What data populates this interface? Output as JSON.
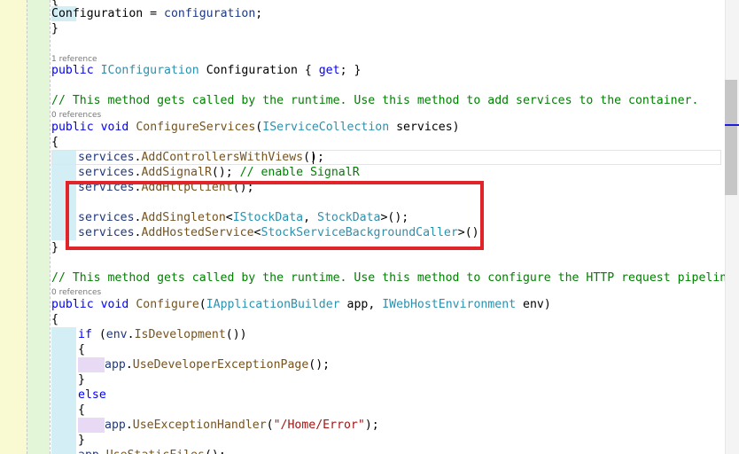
{
  "colors": {
    "gutter_changed": "#fafad2",
    "gutter_saved": "#e3f7d8",
    "indent_guide": "#d4eef6",
    "indent_guide_alt": "#e8d9f4",
    "highlight_box": "#e0242a",
    "keyword": "#0000ff",
    "type": "#2b91af",
    "comment": "#008000",
    "string": "#a31515"
  },
  "code": {
    "lines": [
      {
        "key": "l0",
        "tokens": [
          {
            "t": "{",
            "c": "pl"
          }
        ]
      },
      {
        "key": "l1",
        "tokens": [
          {
            "t": "Configuration",
            "c": "pl"
          },
          {
            "t": " = ",
            "c": "pl"
          },
          {
            "t": "configuration",
            "c": "id"
          },
          {
            "t": ";",
            "c": "pl"
          }
        ]
      },
      {
        "key": "l2",
        "tokens": [
          {
            "t": "}",
            "c": "pl"
          }
        ]
      },
      {
        "key": "l3",
        "tokens": [
          {
            "t": "public",
            "c": "kw"
          },
          {
            "t": " ",
            "c": "pl"
          },
          {
            "t": "IConfiguration",
            "c": "ty"
          },
          {
            "t": " Configuration { ",
            "c": "pl"
          },
          {
            "t": "get",
            "c": "kw"
          },
          {
            "t": "; }",
            "c": "pl"
          }
        ]
      },
      {
        "key": "l4",
        "tokens": [
          {
            "t": "// This method gets called by the runtime. Use this method to add services to the container.",
            "c": "cm"
          }
        ]
      },
      {
        "key": "l5",
        "tokens": [
          {
            "t": "public",
            "c": "kw"
          },
          {
            "t": " ",
            "c": "pl"
          },
          {
            "t": "void",
            "c": "kw"
          },
          {
            "t": " ",
            "c": "pl"
          },
          {
            "t": "ConfigureServices",
            "c": "mt"
          },
          {
            "t": "(",
            "c": "pl"
          },
          {
            "t": "IServiceCollection",
            "c": "ty"
          },
          {
            "t": " services)",
            "c": "pl"
          }
        ]
      },
      {
        "key": "l6",
        "tokens": [
          {
            "t": "{",
            "c": "pl"
          }
        ]
      },
      {
        "key": "l7",
        "tokens": [
          {
            "t": "services",
            "c": "id"
          },
          {
            "t": ".",
            "c": "pl"
          },
          {
            "t": "AddControllersWithViews",
            "c": "mt"
          },
          {
            "t": "();",
            "c": "pl"
          }
        ]
      },
      {
        "key": "l8",
        "tokens": [
          {
            "t": "services",
            "c": "id"
          },
          {
            "t": ".",
            "c": "pl"
          },
          {
            "t": "AddSignalR",
            "c": "mt"
          },
          {
            "t": "(); ",
            "c": "pl"
          },
          {
            "t": "// enable SignalR",
            "c": "cm"
          }
        ]
      },
      {
        "key": "l9",
        "tokens": [
          {
            "t": "services",
            "c": "id"
          },
          {
            "t": ".",
            "c": "pl"
          },
          {
            "t": "AddHttpClient",
            "c": "mt"
          },
          {
            "t": "();",
            "c": "pl"
          }
        ]
      },
      {
        "key": "l10",
        "tokens": []
      },
      {
        "key": "l11",
        "tokens": [
          {
            "t": "services",
            "c": "id"
          },
          {
            "t": ".",
            "c": "pl"
          },
          {
            "t": "AddSingleton",
            "c": "mt"
          },
          {
            "t": "<",
            "c": "pl"
          },
          {
            "t": "IStockData",
            "c": "ty"
          },
          {
            "t": ", ",
            "c": "pl"
          },
          {
            "t": "StockData",
            "c": "ty"
          },
          {
            "t": ">();",
            "c": "pl"
          }
        ]
      },
      {
        "key": "l12",
        "tokens": [
          {
            "t": "services",
            "c": "id"
          },
          {
            "t": ".",
            "c": "pl"
          },
          {
            "t": "AddHostedService",
            "c": "mt"
          },
          {
            "t": "<",
            "c": "pl"
          },
          {
            "t": "StockServiceBackgroundCaller",
            "c": "ty"
          },
          {
            "t": ">();",
            "c": "pl"
          }
        ]
      },
      {
        "key": "l13",
        "tokens": [
          {
            "t": "}",
            "c": "pl"
          }
        ]
      },
      {
        "key": "l14",
        "tokens": [
          {
            "t": "// This method gets called by the runtime. Use this method to configure the HTTP request pipeline.",
            "c": "cm"
          }
        ]
      },
      {
        "key": "l15",
        "tokens": [
          {
            "t": "public",
            "c": "kw"
          },
          {
            "t": " ",
            "c": "pl"
          },
          {
            "t": "void",
            "c": "kw"
          },
          {
            "t": " ",
            "c": "pl"
          },
          {
            "t": "Configure",
            "c": "mt"
          },
          {
            "t": "(",
            "c": "pl"
          },
          {
            "t": "IApplicationBuilder",
            "c": "ty"
          },
          {
            "t": " app, ",
            "c": "pl"
          },
          {
            "t": "IWebHostEnvironment",
            "c": "ty"
          },
          {
            "t": " env)",
            "c": "pl"
          }
        ]
      },
      {
        "key": "l16",
        "tokens": [
          {
            "t": "{",
            "c": "pl"
          }
        ]
      },
      {
        "key": "l17",
        "tokens": [
          {
            "t": "if",
            "c": "kw"
          },
          {
            "t": " (",
            "c": "pl"
          },
          {
            "t": "env",
            "c": "id"
          },
          {
            "t": ".",
            "c": "pl"
          },
          {
            "t": "IsDevelopment",
            "c": "mt"
          },
          {
            "t": "())",
            "c": "pl"
          }
        ]
      },
      {
        "key": "l18",
        "tokens": [
          {
            "t": "{",
            "c": "pl"
          }
        ]
      },
      {
        "key": "l19",
        "tokens": [
          {
            "t": "app",
            "c": "id"
          },
          {
            "t": ".",
            "c": "pl"
          },
          {
            "t": "UseDeveloperExceptionPage",
            "c": "mt"
          },
          {
            "t": "();",
            "c": "pl"
          }
        ]
      },
      {
        "key": "l20",
        "tokens": [
          {
            "t": "}",
            "c": "pl"
          }
        ]
      },
      {
        "key": "l21",
        "tokens": [
          {
            "t": "else",
            "c": "kw"
          }
        ]
      },
      {
        "key": "l22",
        "tokens": [
          {
            "t": "{",
            "c": "pl"
          }
        ]
      },
      {
        "key": "l23",
        "tokens": [
          {
            "t": "app",
            "c": "id"
          },
          {
            "t": ".",
            "c": "pl"
          },
          {
            "t": "UseExceptionHandler",
            "c": "mt"
          },
          {
            "t": "(",
            "c": "pl"
          },
          {
            "t": "\"/Home/Error\"",
            "c": "st"
          },
          {
            "t": ");",
            "c": "pl"
          }
        ]
      },
      {
        "key": "l24",
        "tokens": [
          {
            "t": "}",
            "c": "pl"
          }
        ]
      },
      {
        "key": "l25",
        "tokens": [
          {
            "t": "app",
            "c": "id"
          },
          {
            "t": ".",
            "c": "pl"
          },
          {
            "t": "UseStaticFiles",
            "c": "mt"
          },
          {
            "t": "();",
            "c": "pl"
          }
        ]
      }
    ],
    "code_lens": [
      {
        "key": "cl0",
        "text": "1 reference"
      },
      {
        "key": "cl1",
        "text": "0 references"
      },
      {
        "key": "cl2",
        "text": "0 references"
      }
    ]
  }
}
